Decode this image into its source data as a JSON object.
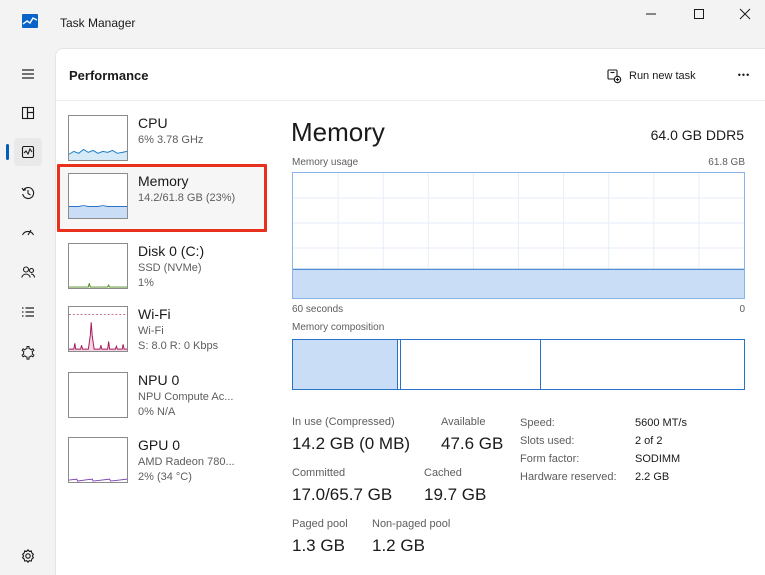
{
  "window": {
    "title": "Task Manager"
  },
  "header": {
    "page_title": "Performance",
    "run_new_task": "Run new task",
    "more": "•••"
  },
  "nav": {
    "items": [
      {
        "icon": "hamburger-menu-icon"
      },
      {
        "icon": "processes-icon"
      },
      {
        "icon": "performance-icon",
        "active": true
      },
      {
        "icon": "app-history-icon"
      },
      {
        "icon": "startup-apps-icon"
      },
      {
        "icon": "users-icon"
      },
      {
        "icon": "details-icon"
      },
      {
        "icon": "services-icon"
      },
      {
        "icon": "settings-gear-icon"
      }
    ]
  },
  "devices": [
    {
      "name": "CPU",
      "sub1": "6% 3.78 GHz",
      "sub2": "",
      "color": "#1a7dc4"
    },
    {
      "name": "Memory",
      "sub1": "14.2/61.8 GB (23%)",
      "sub2": "",
      "color": "#2a72c8",
      "selected": true
    },
    {
      "name": "Disk 0 (C:)",
      "sub1": "SSD (NVMe)",
      "sub2": "1%",
      "color": "#4d8a1e"
    },
    {
      "name": "Wi-Fi",
      "sub1": "Wi-Fi",
      "sub2": "S: 8.0 R: 0 Kbps",
      "color": "#a5195c"
    },
    {
      "name": "NPU 0",
      "sub1": "NPU Compute Ac...",
      "sub2": "0% N/A",
      "color": "#8b8b8b"
    },
    {
      "name": "GPU 0",
      "sub1": "AMD Radeon 780...",
      "sub2": "2% (34 °C)",
      "color": "#7a3fb5"
    }
  ],
  "memory": {
    "title": "Memory",
    "spec": "64.0 GB DDR5",
    "usage_label": "Memory usage",
    "usage_max": "61.8 GB",
    "time_label": "60 seconds",
    "time_zero": "0",
    "usage_fraction": 0.23,
    "composition_label": "Memory composition",
    "stats": {
      "in_use_label": "In use (Compressed)",
      "in_use": "14.2 GB (0 MB)",
      "available_label": "Available",
      "available": "47.6 GB",
      "committed_label": "Committed",
      "committed": "17.0/65.7 GB",
      "cached_label": "Cached",
      "cached": "19.7 GB",
      "paged_label": "Paged pool",
      "paged": "1.3 GB",
      "nonpaged_label": "Non-paged pool",
      "nonpaged": "1.2 GB"
    },
    "specs": [
      {
        "key": "Speed:",
        "value": "5600 MT/s"
      },
      {
        "key": "Slots used:",
        "value": "2 of 2"
      },
      {
        "key": "Form factor:",
        "value": "SODIMM"
      },
      {
        "key": "Hardware reserved:",
        "value": "2.2 GB"
      }
    ]
  },
  "colors": {
    "accent": "#005fb8",
    "memory_fill": "#c9def6",
    "memory_line": "#2a72c8",
    "highlight": "#e8301c"
  }
}
